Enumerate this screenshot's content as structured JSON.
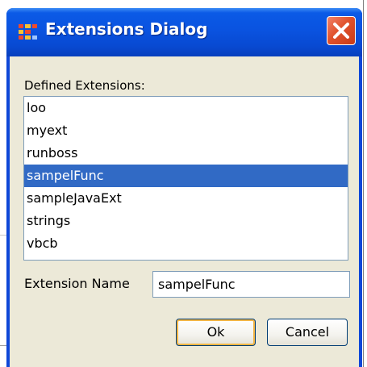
{
  "window": {
    "title": "Extensions Dialog"
  },
  "dialog": {
    "defined_label": "Defined Extensions:",
    "extensions": [
      "loo",
      "myext",
      "runboss",
      "sampelFunc",
      "sampleJavaExt",
      "strings",
      "vbcb"
    ],
    "selected_index": 3,
    "name_label": "Extension Name",
    "name_value": "sampelFunc",
    "ok_label": "Ok",
    "cancel_label": "Cancel"
  },
  "icons": {
    "app": "extensions-app-icon",
    "close": "close-icon"
  },
  "colors": {
    "titlebar": "#0a53e0",
    "selection": "#316ac5",
    "close_button": "#e0522c",
    "dialog_background": "#ece9d8"
  }
}
